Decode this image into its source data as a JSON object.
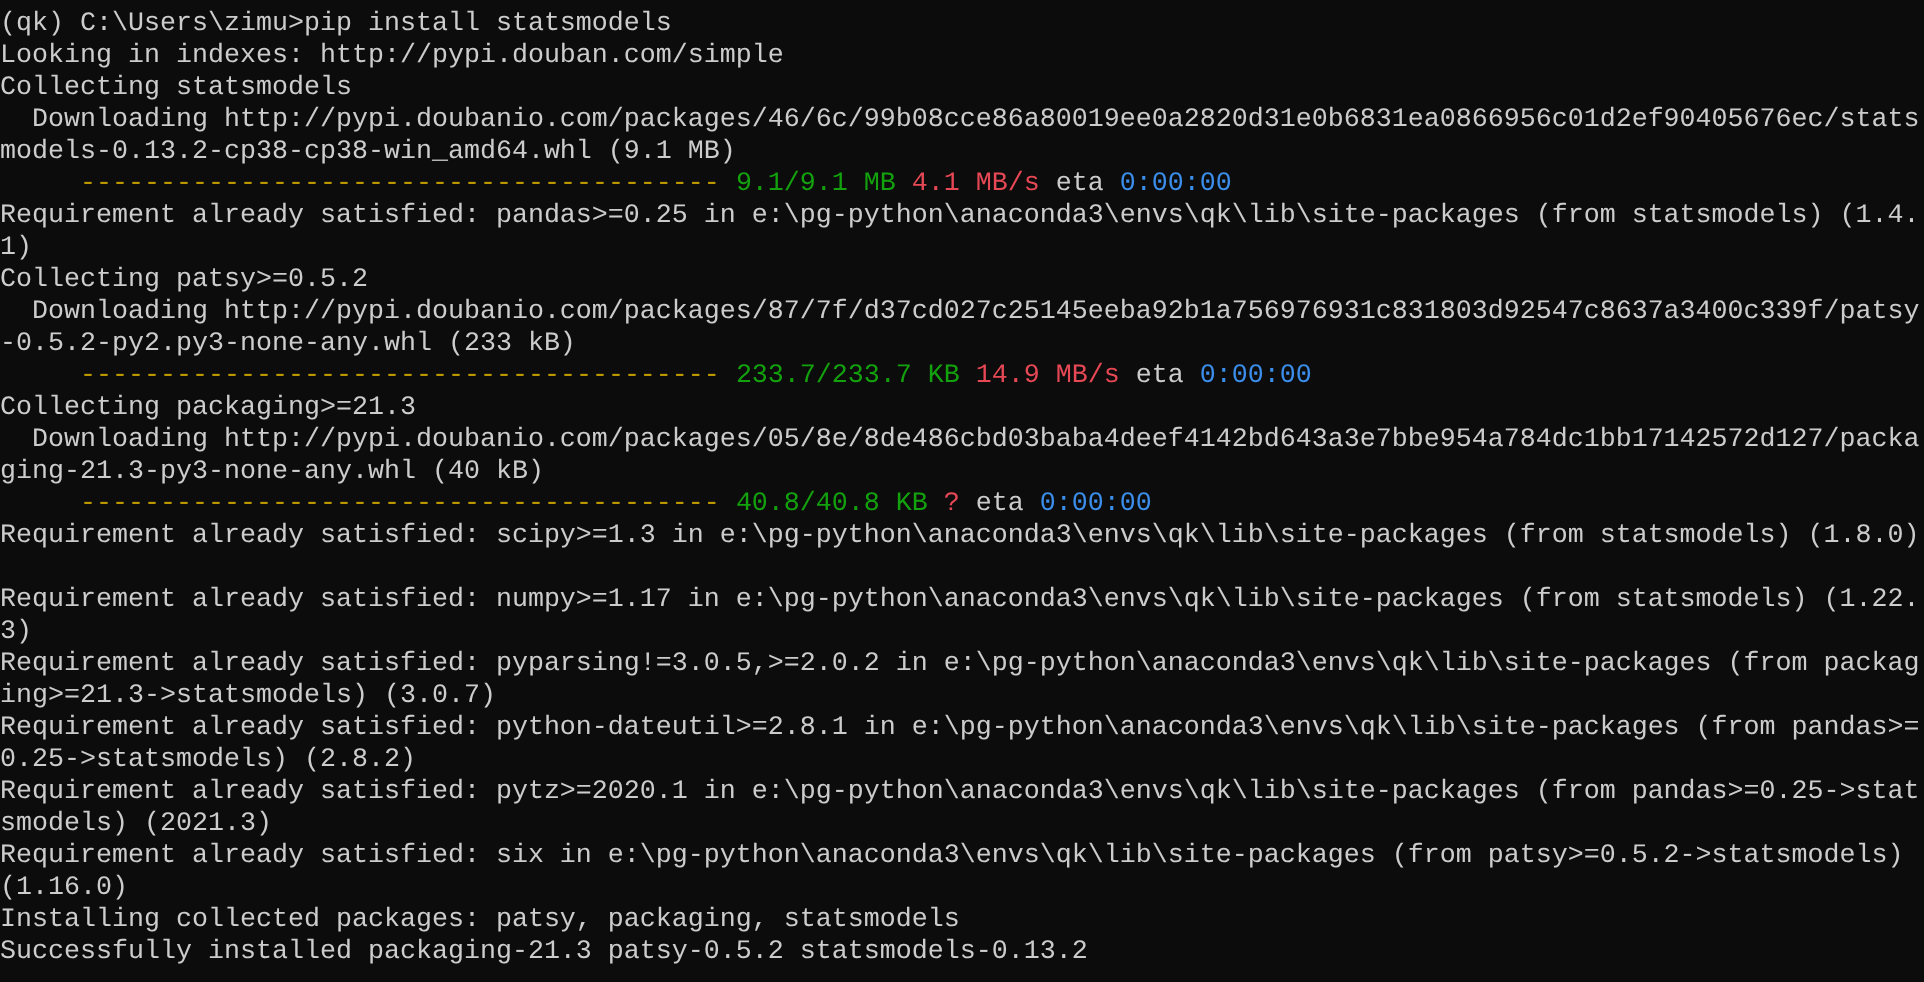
{
  "terminal": {
    "lines": [
      {
        "kind": "text",
        "text": "(qk) C:\\Users\\zimu>pip install statsmodels"
      },
      {
        "kind": "text",
        "text": "Looking in indexes: http://pypi.douban.com/simple"
      },
      {
        "kind": "text",
        "text": "Collecting statsmodels"
      },
      {
        "kind": "text",
        "text": "  Downloading http://pypi.doubanio.com/packages/46/6c/99b08cce86a80019ee0a2820d31e0b6831ea0866956c01d2ef90405676ec/stats"
      },
      {
        "kind": "text",
        "text": "models-0.13.2-cp38-cp38-win_amd64.whl (9.1 MB)"
      },
      {
        "kind": "progress",
        "bar": "----------------------------------------",
        "size": "9.1/9.1 MB",
        "speed": "4.1 MB/s",
        "eta_label": "eta",
        "eta": "0:00:00"
      },
      {
        "kind": "text",
        "text": "Requirement already satisfied: pandas>=0.25 in e:\\pg-python\\anaconda3\\envs\\qk\\lib\\site-packages (from statsmodels) (1.4."
      },
      {
        "kind": "text",
        "text": "1)"
      },
      {
        "kind": "text",
        "text": "Collecting patsy>=0.5.2"
      },
      {
        "kind": "text",
        "text": "  Downloading http://pypi.doubanio.com/packages/87/7f/d37cd027c25145eeba92b1a756976931c831803d92547c8637a3400c339f/patsy"
      },
      {
        "kind": "text",
        "text": "-0.5.2-py2.py3-none-any.whl (233 kB)"
      },
      {
        "kind": "progress",
        "bar": "----------------------------------------",
        "size": "233.7/233.7 KB",
        "speed": "14.9 MB/s",
        "eta_label": "eta",
        "eta": "0:00:00"
      },
      {
        "kind": "text",
        "text": "Collecting packaging>=21.3"
      },
      {
        "kind": "text",
        "text": "  Downloading http://pypi.doubanio.com/packages/05/8e/8de486cbd03baba4deef4142bd643a3e7bbe954a784dc1bb17142572d127/packa"
      },
      {
        "kind": "text",
        "text": "ging-21.3-py3-none-any.whl (40 kB)"
      },
      {
        "kind": "progress",
        "bar": "----------------------------------------",
        "size": "40.8/40.8 KB",
        "speed": "?",
        "eta_label": "eta",
        "eta": "0:00:00"
      },
      {
        "kind": "text",
        "text": "Requirement already satisfied: scipy>=1.3 in e:\\pg-python\\anaconda3\\envs\\qk\\lib\\site-packages (from statsmodels) (1.8.0)"
      },
      {
        "kind": "blank"
      },
      {
        "kind": "text",
        "text": "Requirement already satisfied: numpy>=1.17 in e:\\pg-python\\anaconda3\\envs\\qk\\lib\\site-packages (from statsmodels) (1.22."
      },
      {
        "kind": "text",
        "text": "3)"
      },
      {
        "kind": "text",
        "text": "Requirement already satisfied: pyparsing!=3.0.5,>=2.0.2 in e:\\pg-python\\anaconda3\\envs\\qk\\lib\\site-packages (from packag"
      },
      {
        "kind": "text",
        "text": "ing>=21.3->statsmodels) (3.0.7)"
      },
      {
        "kind": "text",
        "text": "Requirement already satisfied: python-dateutil>=2.8.1 in e:\\pg-python\\anaconda3\\envs\\qk\\lib\\site-packages (from pandas>="
      },
      {
        "kind": "text",
        "text": "0.25->statsmodels) (2.8.2)"
      },
      {
        "kind": "text",
        "text": "Requirement already satisfied: pytz>=2020.1 in e:\\pg-python\\anaconda3\\envs\\qk\\lib\\site-packages (from pandas>=0.25->stat"
      },
      {
        "kind": "text",
        "text": "smodels) (2021.3)"
      },
      {
        "kind": "text",
        "text": "Requirement already satisfied: six in e:\\pg-python\\anaconda3\\envs\\qk\\lib\\site-packages (from patsy>=0.5.2->statsmodels)"
      },
      {
        "kind": "text",
        "text": "(1.16.0)"
      },
      {
        "kind": "text",
        "text": "Installing collected packages: patsy, packaging, statsmodels"
      },
      {
        "kind": "text",
        "text": "Successfully installed packaging-21.3 patsy-0.5.2 statsmodels-0.13.2"
      }
    ]
  }
}
